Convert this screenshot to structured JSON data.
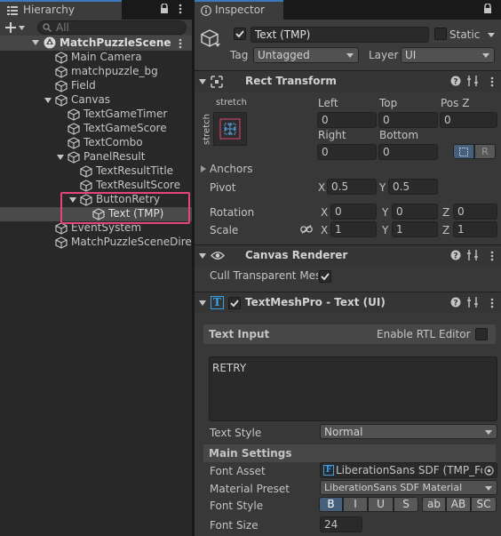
{
  "hierarchy": {
    "tab_label": "Hierarchy",
    "search_placeholder": "All",
    "scene_name": "MatchPuzzleScene",
    "items": [
      {
        "label": "Main Camera"
      },
      {
        "label": "matchpuzzle_bg"
      },
      {
        "label": "Field"
      },
      {
        "label": "Canvas"
      },
      {
        "label": "TextGameTimer"
      },
      {
        "label": "TextGameScore"
      },
      {
        "label": "TextCombo"
      },
      {
        "label": "PanelResult"
      },
      {
        "label": "TextResultTitle"
      },
      {
        "label": "TextResultScore"
      },
      {
        "label": "ButtonRetry"
      },
      {
        "label": "Text (TMP)"
      },
      {
        "label": "EventSystem"
      },
      {
        "label": "MatchPuzzleSceneDire"
      }
    ]
  },
  "inspector": {
    "tab_label": "Inspector",
    "object_name": "Text (TMP)",
    "static_label": "Static",
    "tag_label": "Tag",
    "tag_value": "Untagged",
    "layer_label": "Layer",
    "layer_value": "UI",
    "rect_transform": {
      "title": "Rect Transform",
      "anchor_preset_h": "stretch",
      "anchor_preset_v": "stretch",
      "left_label": "Left",
      "left_value": "0",
      "top_label": "Top",
      "top_value": "0",
      "posz_label": "Pos Z",
      "posz_value": "0",
      "right_label": "Right",
      "right_value": "0",
      "bottom_label": "Bottom",
      "bottom_value": "0",
      "r_button": "R",
      "anchors_label": "Anchors",
      "pivot_label": "Pivot",
      "pivot_x": "0.5",
      "pivot_y": "0.5",
      "rotation_label": "Rotation",
      "rot_x": "0",
      "rot_y": "0",
      "rot_z": "0",
      "scale_label": "Scale",
      "scale_x": "1",
      "scale_y": "1",
      "scale_z": "1",
      "x": "X",
      "y": "Y",
      "z": "Z"
    },
    "canvas_renderer": {
      "title": "Canvas Renderer",
      "cull_label": "Cull Transparent Mesh"
    },
    "tmp": {
      "title": "TextMeshPro - Text (UI)",
      "text_input_label": "Text Input",
      "rtl_label": "Enable RTL Editor",
      "text_value": "RETRY",
      "text_style_label": "Text Style",
      "text_style_value": "Normal",
      "main_settings_label": "Main Settings",
      "font_asset_label": "Font Asset",
      "font_asset_value": "LiberationSans SDF (TMP_Font",
      "material_preset_label": "Material Preset",
      "material_preset_value": "LiberationSans SDF Material",
      "font_style_label": "Font Style",
      "font_style_buttons": [
        "B",
        "I",
        "U",
        "S",
        "ab",
        "AB",
        "SC"
      ],
      "font_size_label": "Font Size",
      "font_size_value": "24"
    }
  },
  "colors": {
    "selection_outline": "#e5457a",
    "accent_blue": "#3a79bb"
  }
}
